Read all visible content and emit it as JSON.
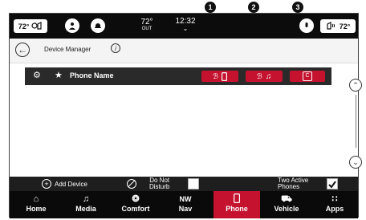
{
  "callouts": [
    "1",
    "2",
    "3"
  ],
  "topbar": {
    "temp_left": "72°",
    "temp_center": "72°",
    "temp_center_sub": "OUT",
    "time": "12:32",
    "temp_right": "72°"
  },
  "header": {
    "title": "Device Manager"
  },
  "device": {
    "name": "Phone Name"
  },
  "bottom": {
    "add_device": "Add Device",
    "dnd_line1": "Do Not",
    "dnd_line2": "Disturb",
    "two_active_line1": "Two Active",
    "two_active_line2": "Phones"
  },
  "nav": [
    {
      "label": "Home",
      "icon": "home-icon"
    },
    {
      "label": "Media",
      "icon": "music-note-icon"
    },
    {
      "label": "Comfort",
      "icon": "fan-icon"
    },
    {
      "label": "Nav",
      "icon": "compass-icon",
      "top": "NW"
    },
    {
      "label": "Phone",
      "icon": "phone-icon",
      "active": true
    },
    {
      "label": "Vehicle",
      "icon": "car-icon"
    },
    {
      "label": "Apps",
      "icon": "grid-icon"
    }
  ],
  "colors": {
    "accent": "#c4122f",
    "background": "#161616"
  }
}
